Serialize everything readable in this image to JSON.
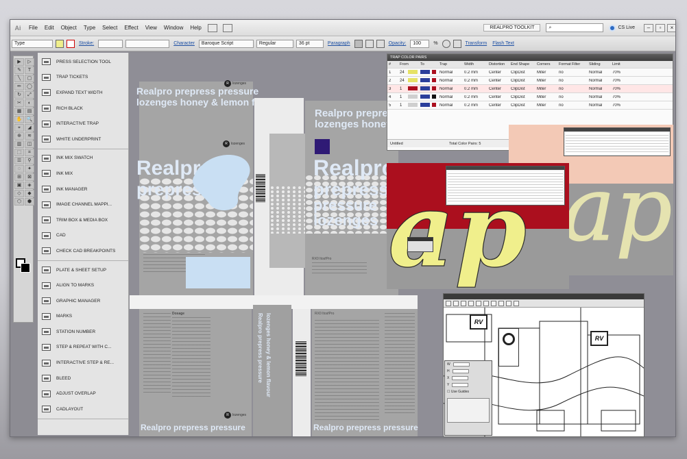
{
  "app": {
    "logo_text": "Ai"
  },
  "menu": [
    "File",
    "Edit",
    "Object",
    "Type",
    "Select",
    "Effect",
    "View",
    "Window",
    "Help"
  ],
  "topbar": {
    "toolkit_label": "REALPRO TOOLKIT",
    "search_placeholder": "",
    "cslive_label": "CS Live"
  },
  "control_bar": {
    "type_label": "Type",
    "stroke_label": "Stroke:",
    "character_label": "Character",
    "font_name": "Baroque Script",
    "font_style": "Regular",
    "font_size": "36 pt",
    "paragraph_label": "Paragraph",
    "opacity_label": "Opacity:",
    "opacity_value": "100",
    "opacity_unit": "%",
    "transform_label": "Transform",
    "flash_text_label": "Flash Text"
  },
  "tools": [
    "▶",
    "▷",
    "✎",
    "T",
    "╲",
    "▢",
    "✏",
    "◯",
    "↻",
    "⤢",
    "✂",
    "◐",
    "▦",
    "▤",
    "✋",
    "🔍",
    "⌖",
    "◢",
    "⊕",
    "≋",
    "▥",
    "◫",
    "⬚",
    "⌗",
    "☰",
    "⚲",
    "◌",
    "✦",
    "⊞",
    "⊠",
    "▣",
    "◈",
    "◇",
    "◆",
    "⬡",
    "⬢"
  ],
  "plugin_groups": [
    [
      "PRESS SELECTION TOOL",
      "TRAP TICKETS",
      "EXPAND TEXT WIDTH",
      "RICH BLACK",
      "INTERACTIVE TRAP",
      "WHITE UNDERPRINT"
    ],
    [
      "INK MIX SWATCH",
      "INK MIX",
      "INK MANAGER",
      "IMAGE CHANNEL MAPPI...",
      "TRIM BOX & MEDIA BOX",
      "CAD",
      "CHECK CAD BREAKPOINTS"
    ],
    [
      "PLATE & SHEET SETUP",
      "ALIGN TO MARKS",
      "GRAPHIC MANAGER",
      "MARKS",
      "STATION NUMBER",
      "STEP & REPEAT WITH C...",
      "INTERACTIVE STEP & RE...",
      "BLEED",
      "ADJUST OVERLAP",
      "CADLAYOUT"
    ]
  ],
  "artwork": {
    "headline_1": "Realpro prepress pressure",
    "headline_2": "lozenges honey & lemon flavour",
    "big_word": "Realpro",
    "big_word_2": "prepress",
    "big_word_3": "pressure",
    "big_word_4": "lozenges",
    "big_word_left_1": "Realpro",
    "big_word_left_2": "prepress",
    "logo_text": "lozenges",
    "ingredient_title": "Dosage",
    "bottom_headline": "Realpro prepress pressure",
    "side_text_1": "Realpro prepress pressure",
    "side_text_2": "lozenges honey & lemon flavour",
    "small_code": "RX0 ItosfPro",
    "label_small": "RX0 ItosfPro"
  },
  "trap_panel": {
    "title": "TRAP COLOR PAIRS",
    "columns": [
      "#",
      "From",
      "To",
      "Trap",
      "Width",
      "Distortion",
      "End Shape",
      "Corners",
      "Format Filter",
      "Sliding",
      "Limit"
    ],
    "rows": [
      {
        "num": "1",
        "from_no": "24",
        "from_color": "#e6e266",
        "to_color": "#2b3e9b",
        "to_sw": "#ab0f1e",
        "trap": "Normal",
        "width": "0.2 mm",
        "dist": "Center",
        "end": "ClipDist",
        "corner": "Miter",
        "filter": "no",
        "sliding": "Normal",
        "limit": "70%"
      },
      {
        "num": "2",
        "from_no": "24",
        "from_color": "#e6e266",
        "to_color": "#2b3e9b",
        "to_sw": "#ab0f1e",
        "trap": "Normal",
        "width": "0.2 mm",
        "dist": "Center",
        "end": "ClipDist",
        "corner": "Miter",
        "filter": "no",
        "sliding": "Normal",
        "limit": "70%"
      },
      {
        "num": "3",
        "from_no": "1",
        "from_color": "#ab0f1e",
        "to_color": "#2b3e9b",
        "to_sw": "#ab0f1e",
        "trap": "Normal",
        "width": "0.2 mm",
        "dist": "Center",
        "end": "ClipDist",
        "corner": "Miter",
        "filter": "no",
        "sliding": "Normal",
        "limit": "70%"
      },
      {
        "num": "4",
        "from_no": "1",
        "from_color": "#cfcfcf",
        "to_color": "#2b3e9b",
        "to_sw": "#111111",
        "trap": "Normal",
        "width": "0.2 mm",
        "dist": "Center",
        "end": "ClipDist",
        "corner": "Miter",
        "filter": "no",
        "sliding": "Normal",
        "limit": "70%"
      },
      {
        "num": "5",
        "from_no": "1",
        "from_color": "#cfcfcf",
        "to_color": "#2b3e9b",
        "to_sw": "#ab0f1e",
        "trap": "Normal",
        "width": "0.2 mm",
        "dist": "Center",
        "end": "ClipDist",
        "corner": "Miter",
        "filter": "no",
        "sliding": "Normal",
        "limit": "70%"
      }
    ],
    "footer_left": "Untitled",
    "footer_right": "Total Color Pairs: 5"
  },
  "colors": {
    "accent_red": "#ab0f1e",
    "lettering_yellow": "#f0ef8c",
    "peach": "#f3c9b6",
    "light_blue": "#c9dff3"
  },
  "lettering": {
    "left": "ap",
    "right": "ap"
  },
  "layout_window": {
    "logo": "RV",
    "dialog_check": "Use Guides"
  }
}
